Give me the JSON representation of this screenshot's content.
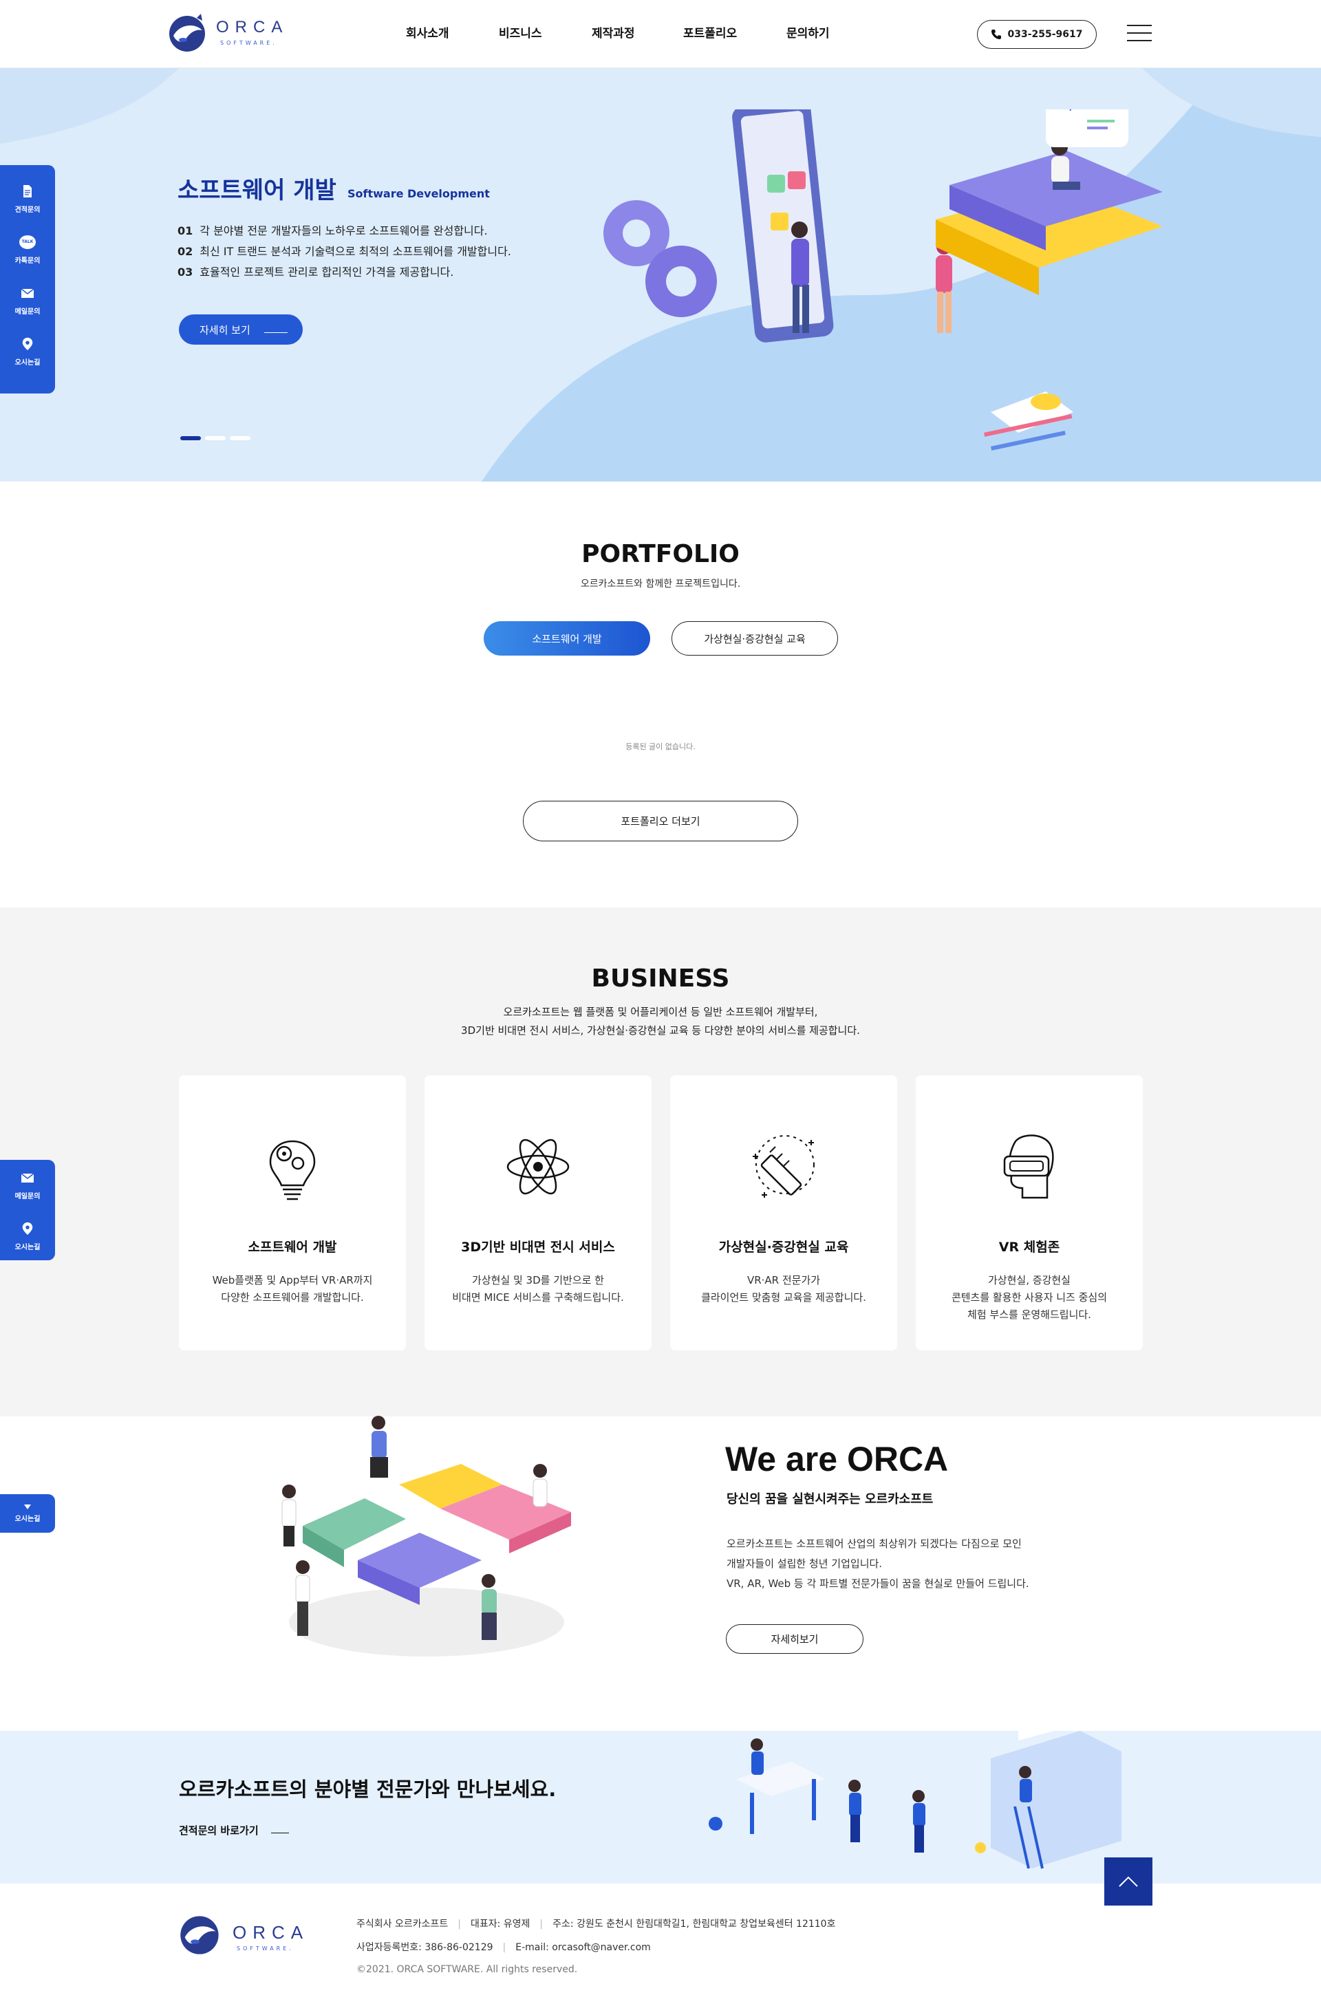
{
  "header": {
    "logo_word": "ORCA",
    "logo_sub": "SOFTWARE.",
    "nav": [
      "회사소개",
      "비즈니스",
      "제작과정",
      "포트폴리오",
      "문의하기"
    ],
    "phone": "033-255-9617"
  },
  "side_menu": {
    "top": [
      {
        "label": "견적문의",
        "icon": "document-icon"
      },
      {
        "label": "카톡문의",
        "icon": "talk-icon",
        "badge": "TALK"
      },
      {
        "label": "메일문의",
        "icon": "mail-icon"
      },
      {
        "label": "오시는길",
        "icon": "location-pin-icon"
      }
    ],
    "mid": [
      {
        "label": "메일문의",
        "icon": "mail-icon"
      },
      {
        "label": "오시는길",
        "icon": "location-pin-icon"
      }
    ],
    "bottom": [
      {
        "label": "오시는길",
        "icon": "location-pin-icon"
      }
    ]
  },
  "hero": {
    "title": "소프트웨어 개발",
    "title_en": "Software Development",
    "points": [
      {
        "num": "01",
        "text": "각 분야별 전문 개발자들의 노하우로 소프트웨어를 완성합니다."
      },
      {
        "num": "02",
        "text": "최신 IT 트랜드 분석과 기술력으로 최적의 소프트웨어를 개발합니다."
      },
      {
        "num": "03",
        "text": "효율적인 프로젝트 관리로 합리적인 가격을 제공합니다."
      }
    ],
    "button": "자세히 보기",
    "code_glyph": "</>",
    "slides_total": 3,
    "slide_active": 1
  },
  "portfolio": {
    "title": "PORTFOLIO",
    "subtitle": "오르카소프트와 함께한 프로젝트입니다.",
    "tabs": [
      "소프트웨어 개발",
      "가상현실·증강현실 교육"
    ],
    "active_tab": 0,
    "empty": "등록된 글이 없습니다.",
    "more": "포트폴리오 더보기"
  },
  "business": {
    "title": "BUSINESS",
    "desc1": "오르카소프트는 웹 플랫폼 및 어플리케이션 등 일반 소프트웨어 개발부터,",
    "desc2": "3D기반 비대면 전시 서비스, 가상현실·증강현실 교육 등 다양한 분야의 서비스를 제공합니다.",
    "cards": [
      {
        "icon": "lightbulb-gear-icon",
        "title": "소프트웨어 개발",
        "lines": [
          "Web플랫폼 및 App부터 VR·AR까지",
          "다양한 소프트웨어를 개발합니다."
        ]
      },
      {
        "icon": "atom-icon",
        "title": "3D기반 비대면 전시 서비스",
        "lines": [
          "가상현실 및 3D를 기반으로 한",
          "비대면 MICE 서비스를 구축해드립니다."
        ]
      },
      {
        "icon": "pencil-icon",
        "title": "가상현실·증강현실 교육",
        "lines": [
          "VR·AR 전문가가",
          "클라이언트 맞춤형 교육을 제공합니다."
        ]
      },
      {
        "icon": "vr-headset-icon",
        "title": "VR 체험존",
        "lines": [
          "가상현실, 증강현실",
          "콘텐츠를 활용한 사용자 니즈 중심의",
          "체험 부스를 운영해드립니다."
        ]
      }
    ]
  },
  "orca": {
    "title": "We are ORCA",
    "subtitle": "당신의 꿈을 실현시켜주는 오르카소프트",
    "lines": [
      "오르카소프트는 소프트웨어 산업의 최상위가 되겠다는 다짐으로 모인",
      "개발자들이 설립한 청년 기업입니다.",
      "VR, AR, Web 등 각 파트별 전문가들이 꿈을 현실로 만들어 드립니다."
    ],
    "button": "자세히보기"
  },
  "banner": {
    "title": "오르카소프트의 분야별 전문가와 만나보세요.",
    "link": "견적문의 바로가기"
  },
  "footer": {
    "company": "주식회사 오르카소프트",
    "ceo": "대표자: 유영제",
    "address": "주소: 강원도 춘천시 한림대학길1, 한림대학교 창업보육센터 12110호",
    "biz_no": "사업자등록번호: 386-86-02129",
    "email": "E-mail: orcasoft@naver.com",
    "copyright": "©2021. ORCA SOFTWARE. All rights reserved."
  },
  "colors": {
    "primary": "#2459d6",
    "navy": "#16339a",
    "hero_bg": "#dcecfb",
    "business_bg": "#f4f4f4",
    "banner_bg": "#e5f1fd"
  }
}
